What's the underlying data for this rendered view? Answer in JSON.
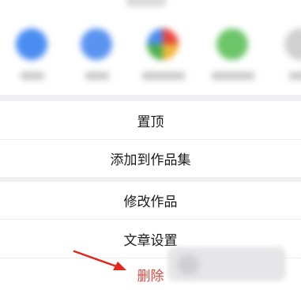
{
  "share_panel": {
    "items": [
      {
        "icon": "share-target-blue-icon",
        "color": "#4a8cf0"
      },
      {
        "icon": "share-target-blue-icon",
        "color": "#5b93f0"
      },
      {
        "icon": "share-target-multicolor-icon",
        "color": "#e8b84a"
      },
      {
        "icon": "share-target-green-icon",
        "color": "#6cc66a"
      },
      {
        "icon": "share-target-gray-icon",
        "color": "#d0d0d0"
      }
    ]
  },
  "actions": {
    "pin_label": "置顶",
    "add_to_collection_label": "添加到作品集",
    "edit_work_label": "修改作品",
    "article_settings_label": "文章设置",
    "delete_label": "删除"
  },
  "colors": {
    "danger": "#e8473f",
    "annotation_arrow": "#e2261c"
  }
}
